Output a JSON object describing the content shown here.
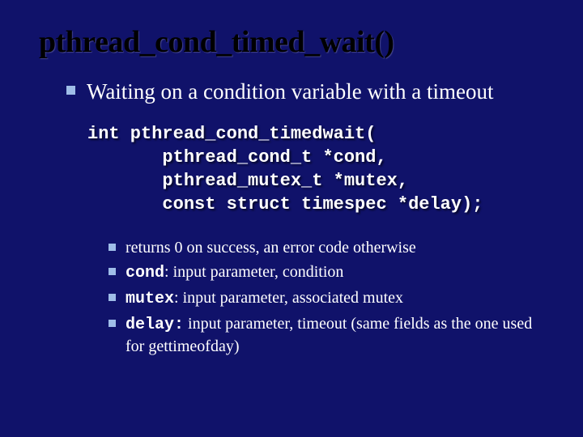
{
  "title": "pthread_cond_timed_wait()",
  "top_bullet": "Waiting on a condition variable with a timeout",
  "code": {
    "l1": "int pthread_cond_timedwait(",
    "l2": "       pthread_cond_t *cond,",
    "l3": "       pthread_mutex_t *mutex,",
    "l4": "       const struct timespec *delay);"
  },
  "sub": {
    "r1": "returns 0 on success, an error code otherwise",
    "r2_code": "cond",
    "r2_rest": ": input parameter, condition",
    "r3_code": "mutex",
    "r3_rest": ": input parameter, associated mutex",
    "r4_code": "delay:",
    "r4_rest": " input parameter, timeout (same fields as the one used for gettimeofday)"
  }
}
